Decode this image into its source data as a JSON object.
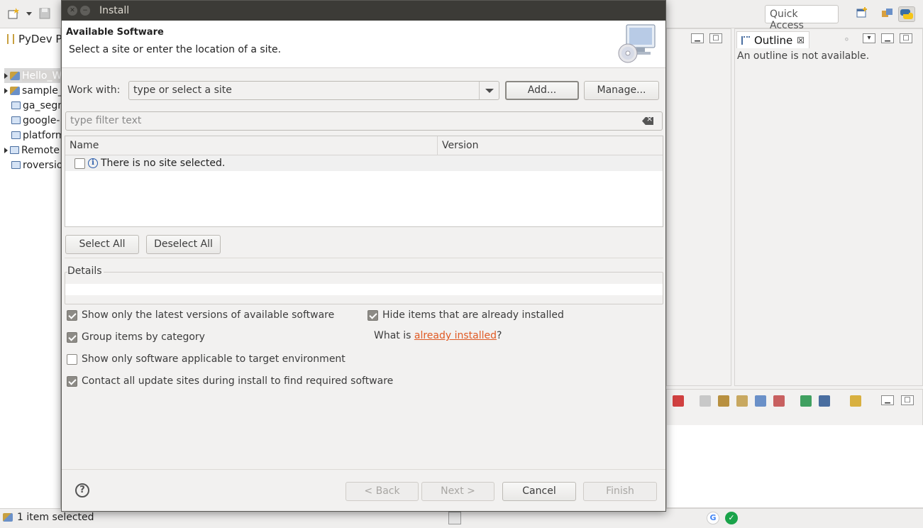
{
  "ide": {
    "quick_access": "Quick Access",
    "left_tab_label": "PyDev Pa",
    "tree_items": [
      {
        "label": "Hello_W",
        "kind": "project",
        "expandable": true,
        "selected": true
      },
      {
        "label": "sample_",
        "kind": "project",
        "expandable": true,
        "selected": false
      },
      {
        "label": "ga_segm",
        "kind": "folder",
        "expandable": false,
        "selected": false
      },
      {
        "label": "google-",
        "kind": "folder",
        "expandable": false,
        "selected": false
      },
      {
        "label": "platform",
        "kind": "folder",
        "expandable": false,
        "selected": false
      },
      {
        "label": "Remote",
        "kind": "folder-open",
        "expandable": true,
        "selected": false
      },
      {
        "label": "roversio",
        "kind": "folder",
        "expandable": false,
        "selected": false
      }
    ],
    "outline_tab": "Outline",
    "outline_message": "An outline is not available.",
    "status_text": "1 item selected"
  },
  "dialog": {
    "title": "Install",
    "banner_title": "Available Software",
    "banner_description": "Select a site or enter the location of a site.",
    "work_with_label": "Work with:",
    "work_with_value": "type or select a site",
    "add_button": "Add...",
    "manage_button": "Manage...",
    "filter_placeholder": "type filter text",
    "table": {
      "columns": [
        "Name",
        "Version"
      ],
      "rows": [
        {
          "name": "There is no site selected.",
          "version": ""
        }
      ]
    },
    "select_all": "Select All",
    "deselect_all": "Deselect All",
    "details_label": "Details",
    "options": {
      "latest_versions": {
        "label": "Show only the latest versions of available software",
        "checked": true
      },
      "group_by_category": {
        "label": "Group items by category",
        "checked": true
      },
      "target_env": {
        "label": "Show only software applicable to target environment",
        "checked": false
      },
      "contact_sites": {
        "label": "Contact all update sites during install to find required software",
        "checked": true
      },
      "hide_installed": {
        "label": "Hide items that are already installed",
        "checked": true
      }
    },
    "what_is_prefix": "What is ",
    "what_is_link": "already installed",
    "what_is_suffix": "?",
    "buttons": {
      "back": "< Back",
      "next": "Next >",
      "cancel": "Cancel",
      "finish": "Finish"
    },
    "help_icon_glyph": "?"
  },
  "colors": {
    "link": "#e05a24",
    "titlebar": "#3c3b37",
    "dialog_bg": "#f2f1f0"
  }
}
